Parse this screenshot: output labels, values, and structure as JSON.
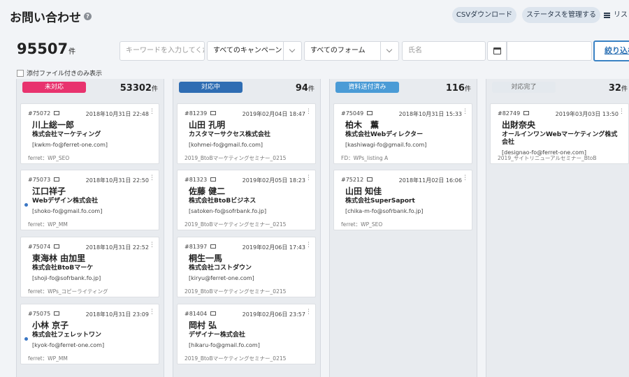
{
  "header": {
    "title": "お問い合わせ",
    "help_icon": "?",
    "csv_button": "CSVダウンロード",
    "status_button": "ステータスを管理する",
    "list_link": "リスト"
  },
  "summary": {
    "total": "95507",
    "unit": "件"
  },
  "filters": {
    "keyword_placeholder": "キーワードを入力してください",
    "campaign": "すべてのキャンペーン",
    "form": "すべてのフォーム",
    "name_placeholder": "氏名",
    "date_value": "",
    "submit": "絞り込む",
    "attachment_only": "添付ファイル付きのみ表示"
  },
  "columns": [
    {
      "status": "未対応",
      "count": "53302",
      "unit": "件",
      "badge_bg": "#e8336e",
      "badge_fg": "#ffffff",
      "cards": [
        {
          "id": "#75072",
          "date": "2018年10月31日 22:48",
          "name": "川上総一郎",
          "company": "株式会社マーケティング",
          "email": "[kwkm-fo@ferret-one.com]",
          "source": "ferret：WP_SEO",
          "unread": false
        },
        {
          "id": "#75073",
          "date": "2018年10月31日 22:50",
          "name": "江口祥子",
          "company": "Webデザイン株式会社",
          "email": "[shoko-fo@gmail.fo.com]",
          "source": "ferret：WP_MM",
          "unread": true
        },
        {
          "id": "#75074",
          "date": "2018年10月31日 22:52",
          "name": "東海林 由加里",
          "company": "株式会社BtoBマーケ",
          "email": "[shoji-fo@sofrbank.fo.jp]",
          "source": "ferret：WPs_コピーライティング",
          "unread": false
        },
        {
          "id": "#75075",
          "date": "2018年10月31日 23:09",
          "name": "小林 京子",
          "company": "株式会社フェレットワン",
          "email": "[kyok-fo@ferret-one.com]",
          "source": "ferret：WP_MM",
          "unread": true
        }
      ]
    },
    {
      "status": "対応中",
      "count": "94",
      "unit": "件",
      "badge_bg": "#2f6db3",
      "badge_fg": "#ffffff",
      "cards": [
        {
          "id": "#81239",
          "date": "2019年02月04日 18:47",
          "name": "山田 孔明",
          "company": "カスタマーサクセス株式会社",
          "email": "[kohmei-fo@gmail.fo.com]",
          "source": "2019_BtoBマーケティングセミナー_0215",
          "unread": false
        },
        {
          "id": "#81323",
          "date": "2019年02月05日 18:23",
          "name": "佐藤 健二",
          "company": "株式会社BtoBビジネス",
          "email": "[satoken-fo@sofrbank.fo.jp]",
          "source": "2019_BtoBマーケティングセミナー_0215",
          "unread": false
        },
        {
          "id": "#81397",
          "date": "2019年02月06日 17:43",
          "name": "桐生一馬",
          "company": "株式会社コストダウン",
          "email": "[kiryu@ferret-one.com]",
          "source": "2019_BtoBマーケティングセミナー_0215",
          "unread": false
        },
        {
          "id": "#81404",
          "date": "2019年02月06日 23:57",
          "name": "岡村 弘",
          "company": "デザイナー株式会社",
          "email": "[hikaru-fo@gmail.fo.com]",
          "source": "2019_BtoBマーケティングセミナー_0215",
          "unread": false
        }
      ]
    },
    {
      "status": "資料送付済み",
      "count": "116",
      "unit": "件",
      "badge_bg": "#4a9bd6",
      "badge_fg": "#ffffff",
      "cards": [
        {
          "id": "#75049",
          "date": "2018年10月31日 15:33",
          "name": "柏木　薫",
          "company": "株式会社Webディレクター",
          "email": "[kashiwagi-fo@gmail.fo.com]",
          "source": "FD：WPs_listing A",
          "unread": false
        },
        {
          "id": "#75212",
          "date": "2018年11月02日 16:06",
          "name": "山田 知佳",
          "company": "株式会社SuperSaport",
          "email": "[chika-m-fo@sofrbank.fo.jp]",
          "source": "ferret：WP_SEO",
          "unread": false
        }
      ]
    },
    {
      "status": "対応完了",
      "count": "32",
      "unit": "件",
      "badge_bg": "#e4e9ee",
      "badge_fg": "#666666",
      "cards": [
        {
          "id": "#82749",
          "date": "2019年03月03日 13:50",
          "name": "出財奈央",
          "company": "オールインワンWebマーケティング株式会社",
          "email": "[designao-fo@ferret-one.com]",
          "source": "2019_サイトリニューアルセミナー_BtoB",
          "unread": false
        }
      ]
    }
  ]
}
